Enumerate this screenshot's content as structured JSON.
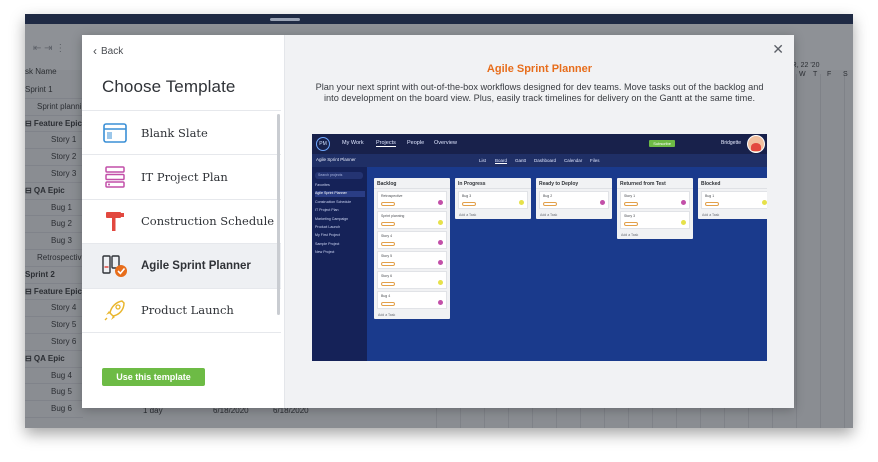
{
  "background": {
    "grid_header": "sk Name",
    "rows": [
      {
        "label": "Sprint 1",
        "level": 0,
        "bold": false
      },
      {
        "label": "Sprint planni",
        "level": 1,
        "bold": false
      },
      {
        "label": "⊟ Feature Epic",
        "level": 0,
        "bold": true
      },
      {
        "label": "Story 1",
        "level": 2,
        "bold": false
      },
      {
        "label": "Story 2",
        "level": 2,
        "bold": false
      },
      {
        "label": "Story 3",
        "level": 2,
        "bold": false
      },
      {
        "label": "⊟ QA Epic",
        "level": 0,
        "bold": true
      },
      {
        "label": "Bug 1",
        "level": 2,
        "bold": false
      },
      {
        "label": "Bug 2",
        "level": 2,
        "bold": false
      },
      {
        "label": "Bug 3",
        "level": 2,
        "bold": false
      },
      {
        "label": "Retrospectiv",
        "level": 1,
        "bold": false
      },
      {
        "label": "Sprint 2",
        "level": 0,
        "bold": true
      },
      {
        "label": "⊟ Feature Epic",
        "level": 0,
        "bold": true
      },
      {
        "label": "Story 4",
        "level": 2,
        "bold": false
      },
      {
        "label": "Story 5",
        "level": 2,
        "bold": false
      },
      {
        "label": "Story 6",
        "level": 2,
        "bold": false
      },
      {
        "label": "⊟ QA Epic",
        "level": 0,
        "bold": true
      },
      {
        "label": "Bug 4",
        "level": 2,
        "bold": false
      },
      {
        "label": "Bug 5",
        "level": 2,
        "bold": false
      },
      {
        "label": "Bug 6",
        "level": 2,
        "bold": false
      }
    ],
    "bottom": {
      "duration": "1 day",
      "start": "6/18/2020",
      "end": "6/18/2020"
    },
    "calendar": {
      "month": "AR, 22 '20",
      "days": [
        "W",
        "T",
        "F",
        "S"
      ]
    }
  },
  "modal": {
    "back_label": "Back",
    "heading": "Choose Template",
    "templates": [
      {
        "label": "Blank Slate",
        "icon": "blank-slate-icon",
        "selected": false
      },
      {
        "label": "IT Project Plan",
        "icon": "it-project-icon",
        "selected": false
      },
      {
        "label": "Construction Schedule",
        "icon": "hammer-icon",
        "selected": false
      },
      {
        "label": "Agile Sprint Planner",
        "icon": "agile-sprint-icon",
        "selected": true
      },
      {
        "label": "Product Launch",
        "icon": "rocket-icon",
        "selected": false
      }
    ],
    "use_button": "Use this template",
    "detail": {
      "title": "Agile Sprint Planner",
      "description": "Plan your next sprint with out-of-the-box workflows designed for dev teams. Move tasks out of the backlog and into development on the board view. Plus, easily track timelines for delivery on the Gantt at the same time."
    },
    "preview": {
      "logo": "PM",
      "nav": [
        "My Work",
        "Projects",
        "People",
        "Overview"
      ],
      "subscribe": "Subscribe",
      "user": "Bridgette",
      "project": "Agile Sprint Planner",
      "tabs": [
        "List",
        "Board",
        "Gantt",
        "Dashboard",
        "Calendar",
        "Files"
      ],
      "search": "Search projects",
      "sidebar": [
        "Favorites",
        "Agile Sprint Planner",
        "Construction Schedule",
        "IT Project Plan",
        "Marketing Campaign",
        "Product Launch",
        "My First Project",
        "Sample Project",
        "New Project"
      ],
      "columns": [
        {
          "title": "Backlog",
          "cards": [
            "Retrospective",
            "Sprint planning",
            "Story 4",
            "Story 5",
            "Story 6",
            "Bug 4"
          ]
        },
        {
          "title": "In Progress",
          "cards": [
            "Bug 3"
          ]
        },
        {
          "title": "Ready to Deploy",
          "cards": [
            "Bug 2"
          ]
        },
        {
          "title": "Returned from Test",
          "cards": [
            "Story 1",
            "Story 3"
          ]
        },
        {
          "title": "Blocked",
          "cards": [
            "Bug 1"
          ]
        }
      ],
      "add_task": "Add a Task"
    }
  },
  "colors": {
    "accent_orange": "#e76d1b",
    "button_green": "#6dbb45",
    "preview_blue": "#1a3a8c"
  }
}
